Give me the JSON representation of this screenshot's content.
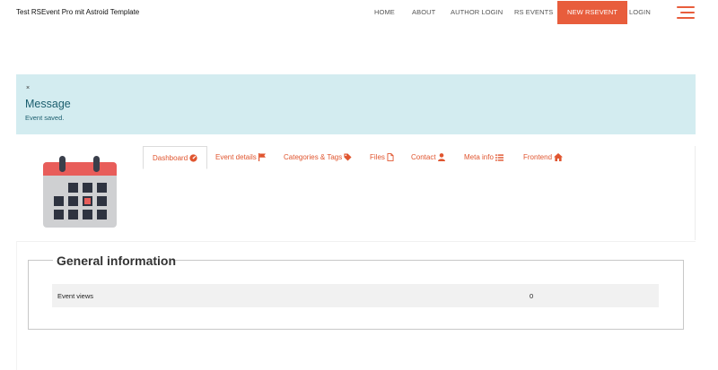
{
  "header": {
    "site_title": "Test RSEvent Pro mit Astroid Template",
    "nav": [
      {
        "label": "Home"
      },
      {
        "label": "About"
      },
      {
        "label": "Author Login"
      },
      {
        "label": "RS Events"
      },
      {
        "label": "New RSEvent"
      },
      {
        "label": "Login"
      }
    ]
  },
  "alert": {
    "close": "×",
    "heading": "Message",
    "text": "Event saved."
  },
  "tabs": [
    {
      "label": "Dashboard",
      "icon": "dashboard-icon"
    },
    {
      "label": "Event details",
      "icon": "flag-icon"
    },
    {
      "label": "Categories & Tags",
      "icon": "tag-icon"
    },
    {
      "label": "Files",
      "icon": "file-icon"
    },
    {
      "label": "Contact",
      "icon": "user-icon"
    },
    {
      "label": "Meta info",
      "icon": "list-icon"
    },
    {
      "label": "Frontend",
      "icon": "home-icon"
    }
  ],
  "general": {
    "legend": "General information",
    "rows": [
      {
        "label": "Event views",
        "value": "0"
      }
    ]
  },
  "colors": {
    "accent": "#e85d3c",
    "alert_bg": "#d3ecf0",
    "alert_text": "#1b5e6e"
  }
}
